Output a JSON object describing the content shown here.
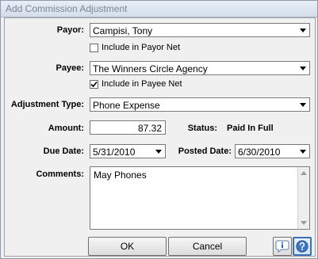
{
  "window": {
    "title": "Add Commission Adjustment"
  },
  "form": {
    "payor": {
      "label": "Payor:",
      "value": "Campisi, Tony"
    },
    "include_payor_net": {
      "label": "Include in Payor Net",
      "checked": false
    },
    "payee": {
      "label": "Payee:",
      "value": "The Winners Circle Agency"
    },
    "include_payee_net": {
      "label": "Include in Payee Net",
      "checked": true
    },
    "adjustment_type": {
      "label": "Adjustment Type:",
      "value": "Phone Expense"
    },
    "amount": {
      "label": "Amount:",
      "value": "87.32"
    },
    "status": {
      "label": "Status:",
      "value": "Paid In Full"
    },
    "due_date": {
      "label": "Due Date:",
      "value": "5/31/2010"
    },
    "posted_date": {
      "label": "Posted Date:",
      "value": "6/30/2010"
    },
    "comments": {
      "label": "Comments:",
      "value": "May Phones"
    }
  },
  "buttons": {
    "ok": "OK",
    "cancel": "Cancel"
  },
  "icons": {
    "info": "info-icon",
    "help": "help-icon"
  }
}
